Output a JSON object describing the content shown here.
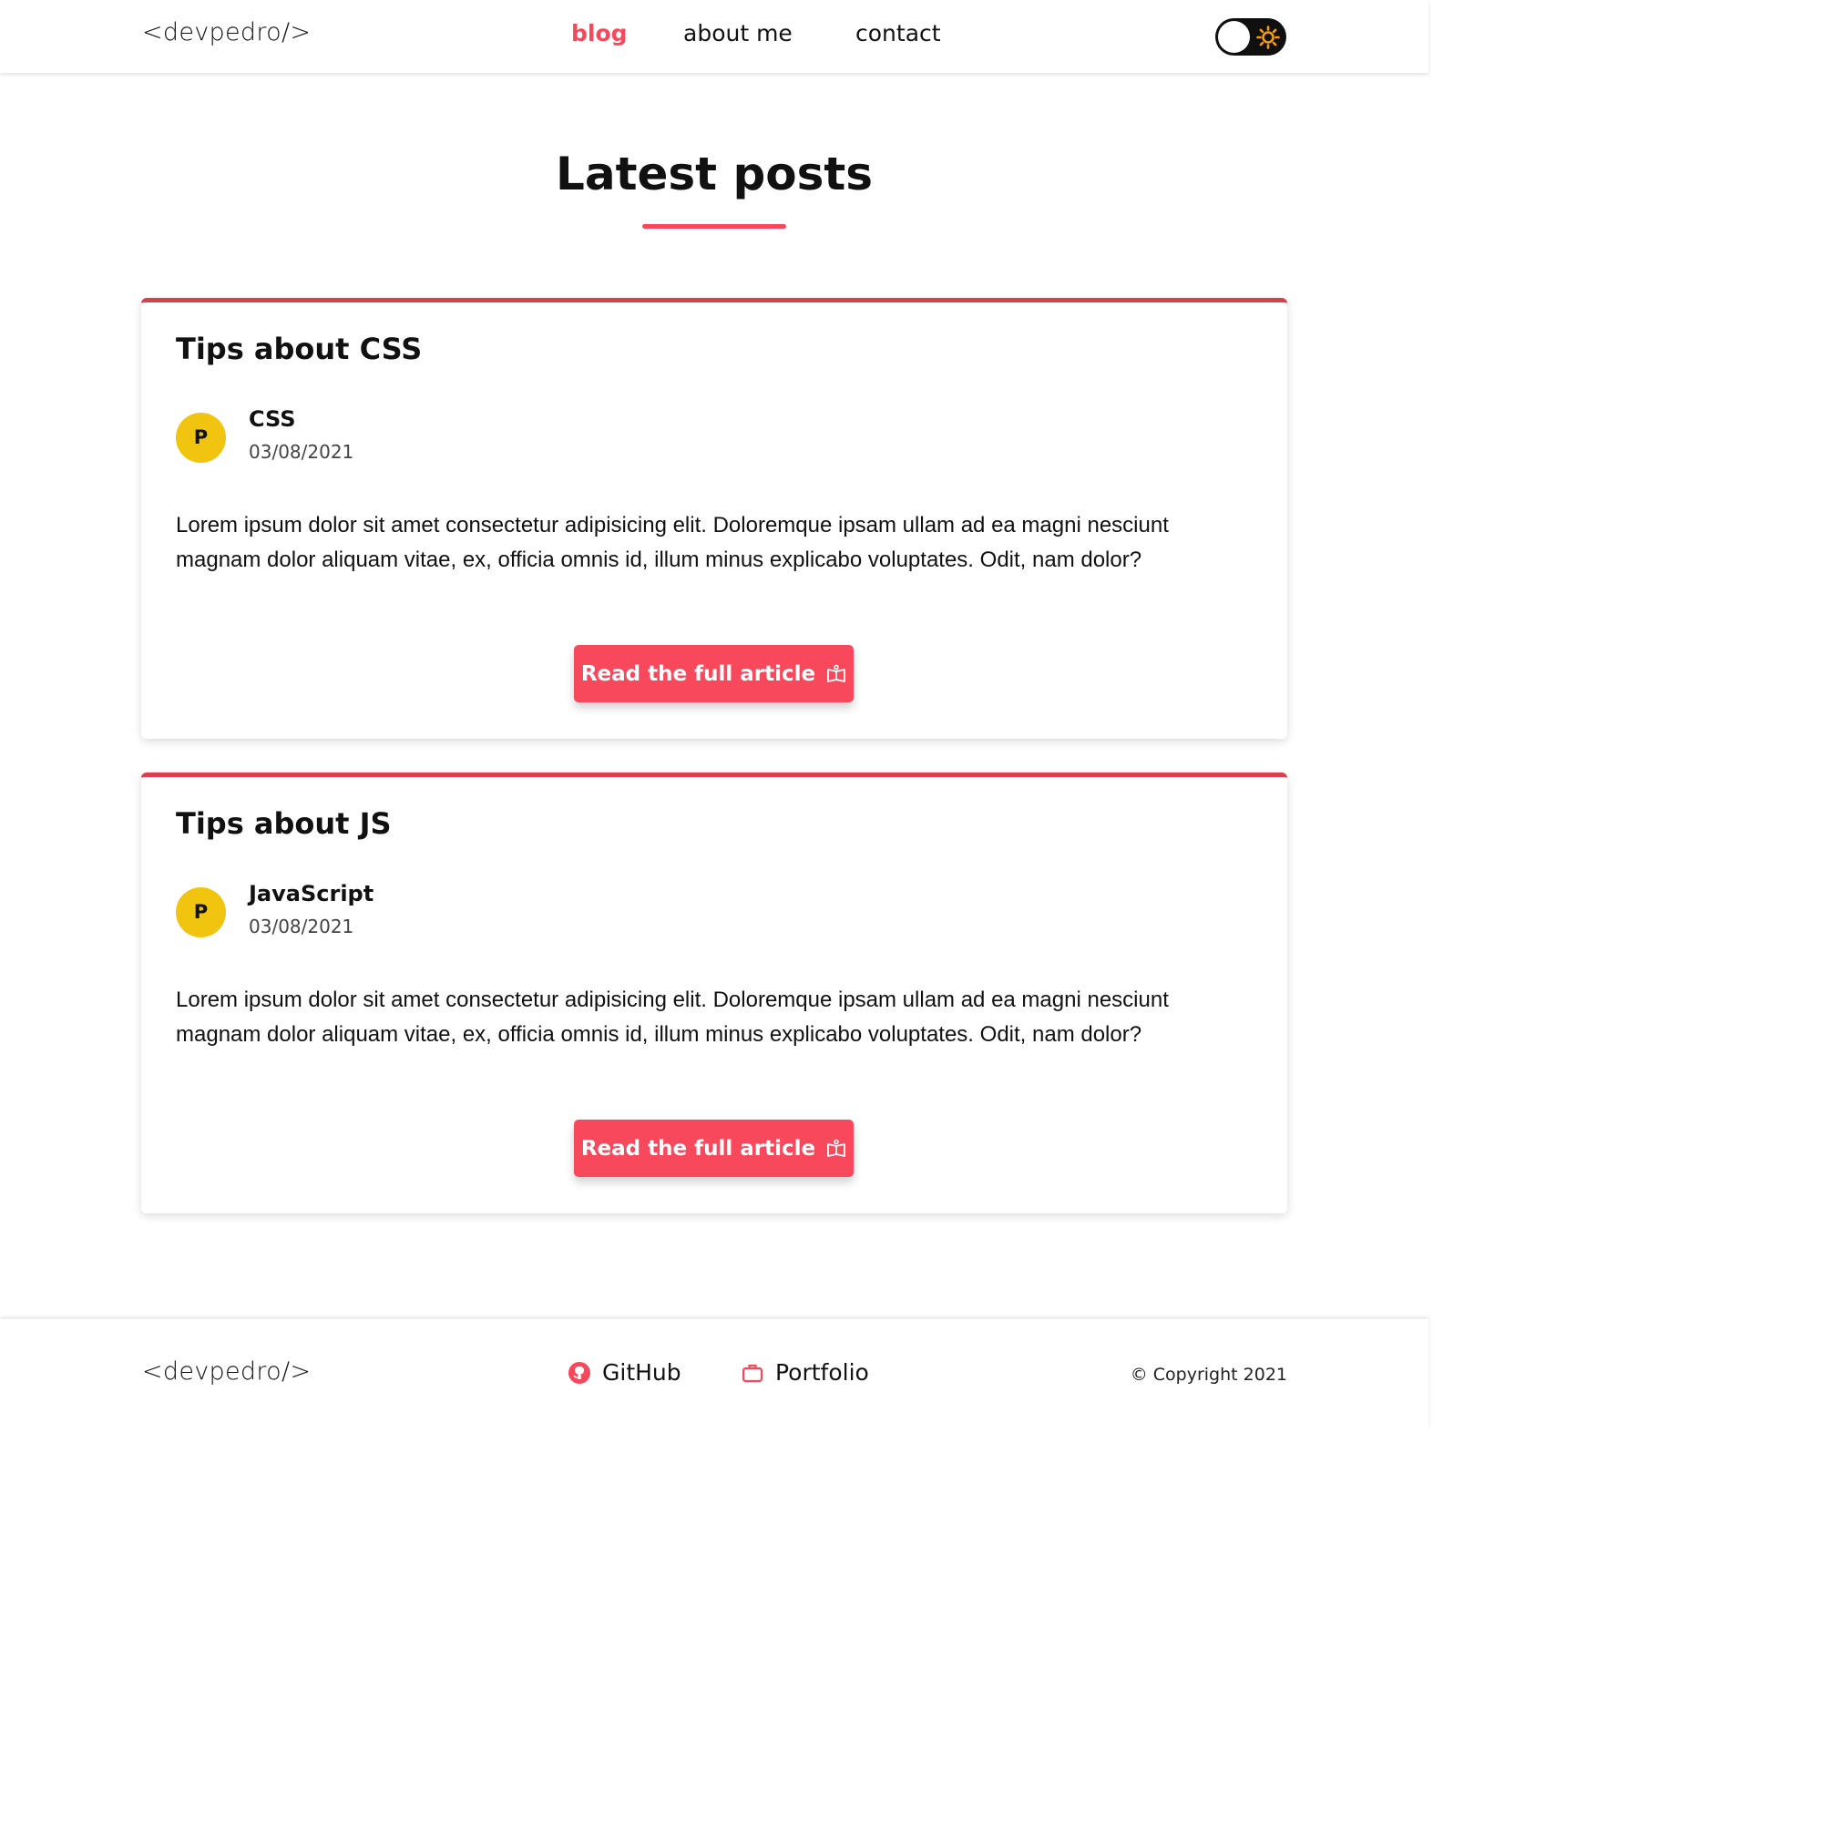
{
  "header": {
    "logo": "<devpedro/>",
    "nav": [
      {
        "label": "blog",
        "active": true
      },
      {
        "label": "about me",
        "active": false
      },
      {
        "label": "contact",
        "active": false
      }
    ],
    "theme_toggle_icon": "sun-icon"
  },
  "main": {
    "title": "Latest posts",
    "posts": [
      {
        "title": "Tips about CSS",
        "avatar_letter": "P",
        "category": "CSS",
        "date": "03/08/2021",
        "excerpt": "Lorem ipsum dolor sit amet consectetur adipisicing elit. Doloremque ipsam ullam ad ea magni nesciunt magnam dolor aliquam vitae, ex, officia omnis id, illum minus explicabo voluptates. Odit, nam dolor?",
        "button_label": "Read the full article",
        "button_icon": "book-open-icon"
      },
      {
        "title": "Tips about JS",
        "avatar_letter": "P",
        "category": "JavaScript",
        "date": "03/08/2021",
        "excerpt": "Lorem ipsum dolor sit amet consectetur adipisicing elit. Doloremque ipsam ullam ad ea magni nesciunt magnam dolor aliquam vitae, ex, officia omnis id, illum minus explicabo voluptates. Odit, nam dolor?",
        "button_label": "Read the full article",
        "button_icon": "book-open-icon"
      }
    ]
  },
  "footer": {
    "logo": "<devpedro/>",
    "links": [
      {
        "label": "GitHub",
        "icon": "github-icon"
      },
      {
        "label": "Portfolio",
        "icon": "briefcase-icon"
      }
    ],
    "copyright": "© Copyright 2021"
  },
  "colors": {
    "accent": "#f7485c",
    "card_border": "#d8404e",
    "avatar": "#f1c40f",
    "toggle_bg": "#101010",
    "sun": "#f39c12"
  }
}
